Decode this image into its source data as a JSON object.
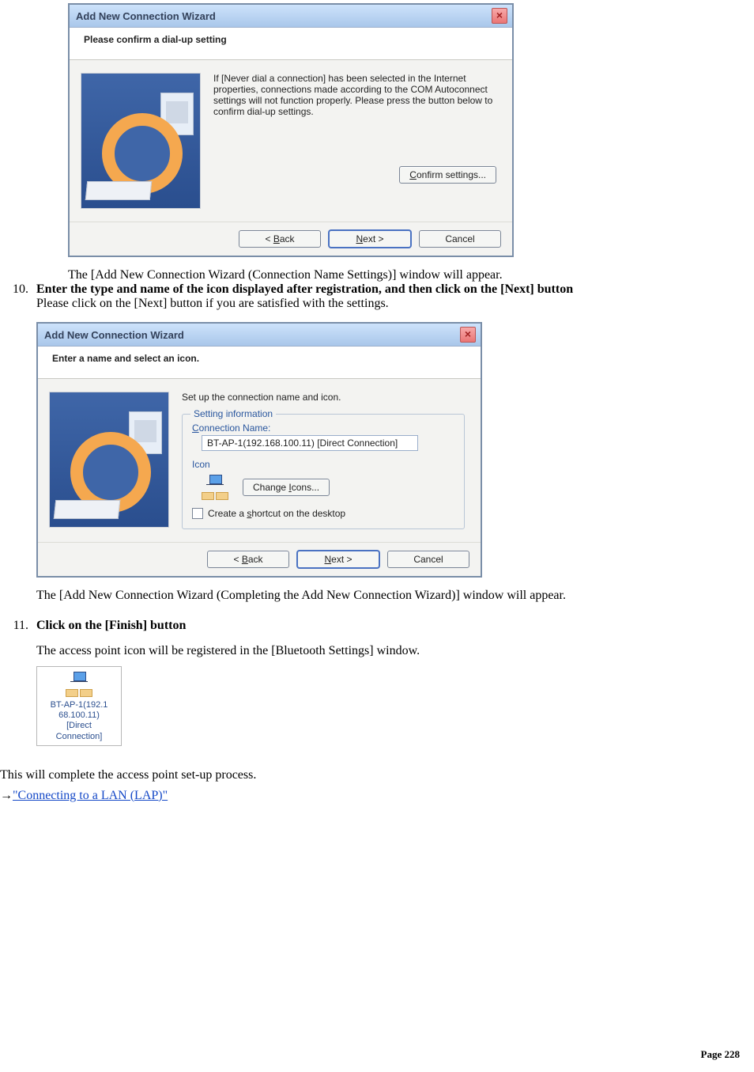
{
  "dialog1": {
    "title": "Add New Connection Wizard",
    "subheader": "Please confirm a dial-up setting",
    "body_text": "If [Never dial a connection] has been selected in the Internet properties, connections made according to the COM Autoconnect settings will not function properly. Please press the button below to confirm dial-up settings.",
    "confirm_btn": "Confirm settings...",
    "back_btn": "< Back",
    "next_btn": "Next >",
    "cancel_btn": "Cancel"
  },
  "after_dialog1": "The [Add New Connection Wizard (Connection Name Settings)] window will appear.",
  "step10": {
    "title": "Enter the type and name of the icon displayed after registration, and then click on the [Next] button",
    "subtext": "Please click on the [Next] button if you are satisfied with the settings."
  },
  "dialog2": {
    "title": "Add New Connection Wizard",
    "subheader": "Enter a name and select an icon.",
    "top_text": "Set up the connection name and icon.",
    "fieldset_legend": "Setting information",
    "conn_name_label": "Connection Name:",
    "conn_name_value": "BT-AP-1(192.168.100.11) [Direct Connection]",
    "icon_label": "Icon",
    "change_icons_btn": "Change Icons...",
    "chk_label": "Create a shortcut on the desktop",
    "back_btn": "< Back",
    "next_btn": "Next >",
    "cancel_btn": "Cancel"
  },
  "after_dialog2": "The [Add New Connection Wizard (Completing the Add New Connection Wizard)] window will appear.",
  "step11": {
    "title": "Click on the [Finish] button",
    "subtext": "The access point icon will be registered in the [Bluetooth Settings] window."
  },
  "desktop_icon_caption": "BT-AP-1(192.168.100.11) [Direct Connection]",
  "final_line": "This will complete the access point set-up process.",
  "link_text": "\"Connecting to a LAN (LAP)\"",
  "page_label": "Page 228"
}
